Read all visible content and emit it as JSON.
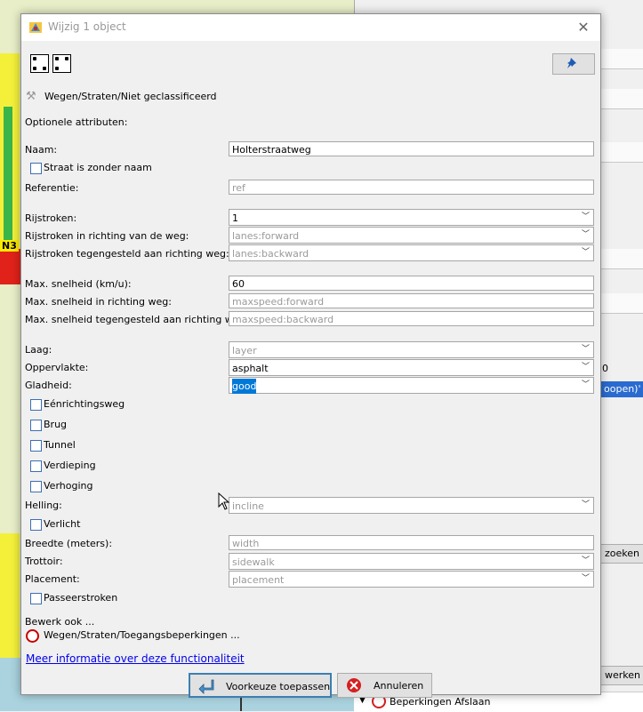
{
  "dialog": {
    "title": "Wijzig 1 object",
    "preset_path": "Wegen/Straten/Niet geclassificeerd",
    "optional_attributes_heading": "Optionele attributen:"
  },
  "form": {
    "naam_label": "Naam:",
    "naam_value": "Holterstraatweg",
    "zonder_naam_label": "Straat is zonder naam",
    "referentie_label": "Referentie:",
    "referentie_placeholder": "ref",
    "rijstroken_label": "Rijstroken:",
    "rijstroken_value": "1",
    "rijstroken_fwd_label": "Rijstroken in richting van de weg:",
    "rijstroken_fwd_placeholder": "lanes:forward",
    "rijstroken_bwd_label": "Rijstroken tegengesteld aan richting weg:",
    "rijstroken_bwd_placeholder": "lanes:backward",
    "maxspeed_label": "Max. snelheid (km/u):",
    "maxspeed_value": "60",
    "maxspeed_fwd_label": "Max. snelheid in richting weg:",
    "maxspeed_fwd_placeholder": "maxspeed:forward",
    "maxspeed_bwd_label": "Max. snelheid tegengesteld aan richting weg:",
    "maxspeed_bwd_placeholder": "maxspeed:backward",
    "laag_label": "Laag:",
    "laag_placeholder": "layer",
    "oppervlakte_label": "Oppervlakte:",
    "oppervlakte_value": "asphalt",
    "gladheid_label": "Gladheid:",
    "gladheid_value": "good",
    "eenrichtingsweg_label": "Eénrichtingsweg",
    "brug_label": "Brug",
    "tunnel_label": "Tunnel",
    "verdieping_label": "Verdieping",
    "verhoging_label": "Verhoging",
    "helling_label": "Helling:",
    "helling_placeholder": "incline",
    "verlicht_label": "Verlicht",
    "breedte_label": "Breedte (meters):",
    "breedte_placeholder": "width",
    "trottoir_label": "Trottoir:",
    "trottoir_placeholder": "sidewalk",
    "placement_label": "Placement:",
    "placement_placeholder": "placement",
    "passeerstroken_label": "Passeerstroken"
  },
  "also_edit": {
    "heading": "Bewerk ook ...",
    "item": "Wegen/Straten/Toegangsbeperkingen ..."
  },
  "more_info_link": "Meer informatie over deze functionaliteit",
  "buttons": {
    "apply": "Voorkeuze toepassen",
    "cancel": "Annuleren"
  },
  "background": {
    "map_label": "N3",
    "panel_button_1": "oopen)'",
    "panel_button_2": "zoeken",
    "panel_button_3": "werken",
    "panel_number": "0",
    "bottom_item": "Beperkingen Afslaan"
  },
  "colors": {
    "accent": "#0078d7",
    "link": "#0000ee",
    "cancel_icon": "#d42020",
    "radio_ring": "#c80000"
  }
}
